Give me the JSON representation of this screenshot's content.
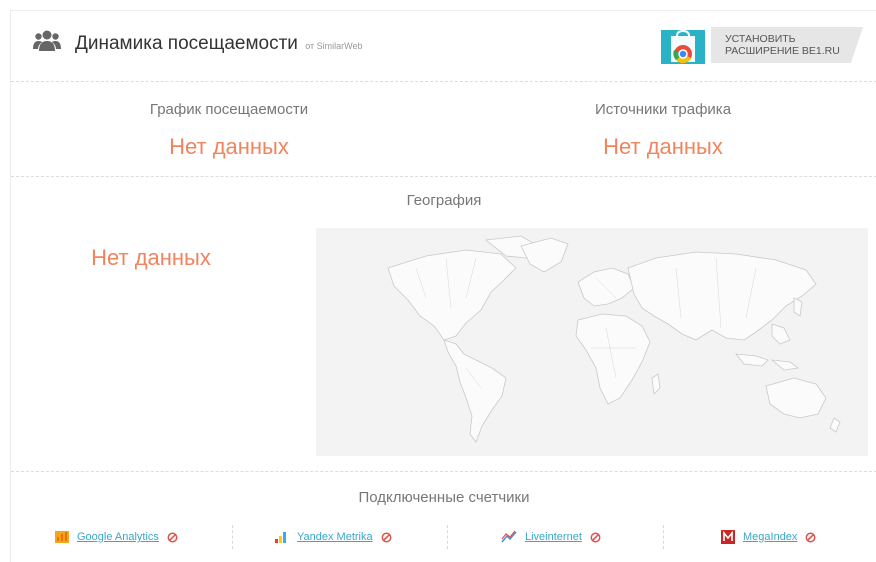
{
  "header": {
    "title": "Динамика посещаемости",
    "source": "от SimilarWeb",
    "icon": "users-icon",
    "install_button": {
      "line1": "УСТАНОВИТЬ",
      "line2": "РАСШИРЕНИЕ BE1.RU",
      "icon": "chrome-store-icon"
    }
  },
  "traffic": {
    "title": "График посещаемости",
    "value": "Нет данных"
  },
  "sources": {
    "title": "Источники трафика",
    "value": "Нет данных"
  },
  "geo": {
    "title": "География",
    "value": "Нет данных"
  },
  "counters": {
    "title": "Подключенные счетчики",
    "items": [
      {
        "label": "Google Analytics",
        "icon": "google-analytics-icon"
      },
      {
        "label": "Yandex Metrika",
        "icon": "yandex-metrika-icon"
      },
      {
        "label": "Liveinternet",
        "icon": "liveinternet-icon"
      },
      {
        "label": "MegaIndex",
        "icon": "megaindex-icon"
      }
    ]
  },
  "colors": {
    "accent": "#f0845f",
    "link": "#3aa7c9",
    "ban": "#e0504a"
  }
}
